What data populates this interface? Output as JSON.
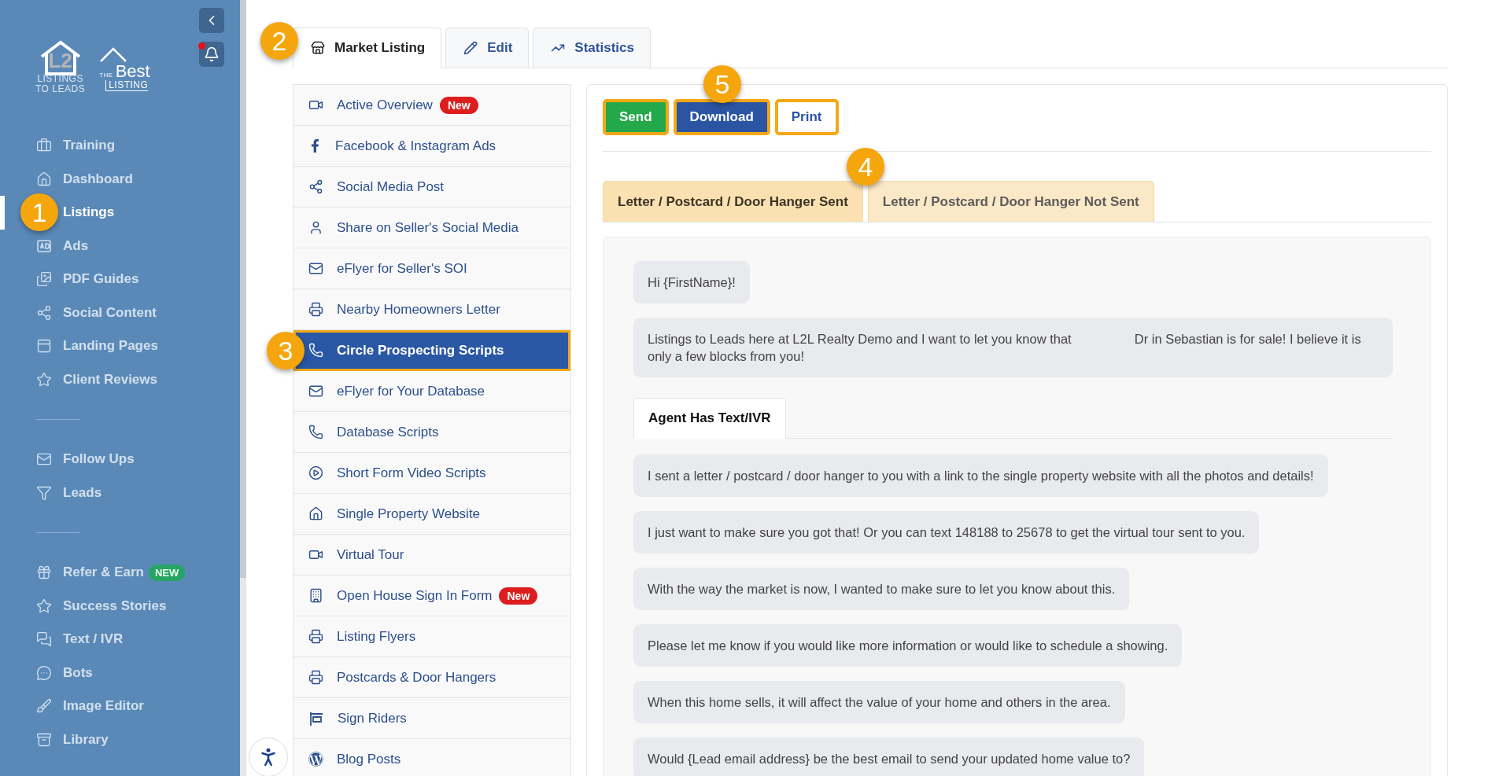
{
  "logos": {
    "primary": {
      "mark": "L2",
      "lines": [
        "LISTINGS",
        "TO LEADS"
      ]
    },
    "secondary": {
      "small": "THE",
      "big": "Best",
      "line": "LISTING"
    }
  },
  "notifications": {
    "unread": true
  },
  "sidebar": {
    "groups": [
      {
        "items": [
          {
            "label": "Training",
            "selected": false
          },
          {
            "label": "Dashboard",
            "selected": false
          },
          {
            "label": "Listings",
            "selected": true
          },
          {
            "label": "Ads",
            "selected": false
          },
          {
            "label": "PDF Guides",
            "selected": false
          },
          {
            "label": "Social Content",
            "selected": false
          },
          {
            "label": "Landing Pages",
            "selected": false
          },
          {
            "label": "Client Reviews",
            "selected": false
          }
        ]
      },
      {
        "items": [
          {
            "label": "Follow Ups",
            "selected": false
          },
          {
            "label": "Leads",
            "selected": false
          }
        ]
      },
      {
        "items": [
          {
            "label": "Refer & Earn",
            "selected": false,
            "badge": "NEW"
          },
          {
            "label": "Success Stories",
            "selected": false
          },
          {
            "label": "Text / IVR",
            "selected": false
          },
          {
            "label": "Bots",
            "selected": false
          },
          {
            "label": "Image Editor",
            "selected": false
          },
          {
            "label": "Library",
            "selected": false
          }
        ]
      }
    ]
  },
  "tabs": [
    {
      "label": "Market Listing",
      "selected": true
    },
    {
      "label": "Edit",
      "selected": false
    },
    {
      "label": "Statistics",
      "selected": false
    }
  ],
  "menu": [
    {
      "label": "Active Overview",
      "selected": false,
      "badge": "New"
    },
    {
      "label": "Facebook & Instagram Ads",
      "selected": false
    },
    {
      "label": "Social Media Post",
      "selected": false
    },
    {
      "label": "Share on Seller's Social Media",
      "selected": false
    },
    {
      "label": "eFlyer for Seller's SOI",
      "selected": false
    },
    {
      "label": "Nearby Homeowners Letter",
      "selected": false
    },
    {
      "label": "Circle Prospecting Scripts",
      "selected": true
    },
    {
      "label": "eFlyer for Your Database",
      "selected": false
    },
    {
      "label": "Database Scripts",
      "selected": false
    },
    {
      "label": "Short Form Video Scripts",
      "selected": false
    },
    {
      "label": "Single Property Website",
      "selected": false
    },
    {
      "label": "Virtual Tour",
      "selected": false
    },
    {
      "label": "Open House Sign In Form",
      "selected": false,
      "badge": "New"
    },
    {
      "label": "Listing Flyers",
      "selected": false
    },
    {
      "label": "Postcards & Door Hangers",
      "selected": false
    },
    {
      "label": "Sign Riders",
      "selected": false
    },
    {
      "label": "Blog Posts",
      "selected": false
    }
  ],
  "actions": [
    {
      "label": "Send",
      "kind": "success",
      "highlighted": true
    },
    {
      "label": "Download",
      "kind": "primary",
      "highlighted": true
    },
    {
      "label": "Print",
      "kind": "outline",
      "highlighted": true
    }
  ],
  "script_tabs": [
    {
      "label": "Letter / Postcard / Door Hanger Sent",
      "selected": true
    },
    {
      "label": "Letter / Postcard / Door Hanger Not Sent",
      "selected": false
    }
  ],
  "intro_messages": [
    {
      "parts": [
        "Hi {FirstName}!"
      ]
    },
    {
      "parts": [
        "Listings to Leads here at L2L Realty Demo and I want to let you know that",
        "Dr in Sebastian is for sale! I believe it is only a few blocks from you!"
      ]
    }
  ],
  "sub_tabs": [
    {
      "label": "Agent Has Text/IVR",
      "selected": true
    }
  ],
  "messages": [
    {
      "parts": [
        "I sent a letter / postcard / door hanger to you with a link to the single property website with all the photos and details!"
      ]
    },
    {
      "parts": [
        "I just want to make sure you got that! Or you can text 148188 to 25678 to get the virtual tour sent to you."
      ]
    },
    {
      "parts": [
        "With the way the market is now, I wanted to make sure to let you know about this."
      ]
    },
    {
      "parts": [
        "Please let me know if you would like more information or would like to schedule a showing."
      ]
    },
    {
      "parts": [
        "When this home sells, it will affect the value of your home and others in the area."
      ]
    },
    {
      "parts": [
        "Would {Lead email address} be the best email to send your updated home value to?"
      ]
    }
  ],
  "callouts": [
    {
      "label": "1"
    },
    {
      "label": "2"
    },
    {
      "label": "3"
    },
    {
      "label": "4"
    },
    {
      "label": "5"
    }
  ]
}
